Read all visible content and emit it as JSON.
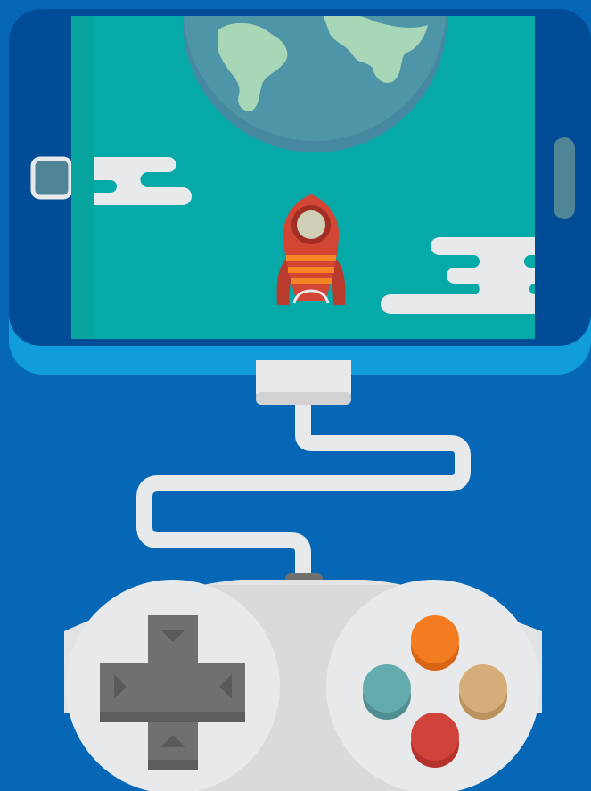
{
  "illustration": {
    "subject": "mobile-gaming",
    "icons": [
      "smartphone-icon",
      "earth-icon",
      "rocket-icon",
      "cloud-icon",
      "cable-icon",
      "gamepad-icon",
      "dpad-icon",
      "action-buttons-icon"
    ]
  },
  "colors": {
    "background": "#0567b6",
    "phone_body": "#004c97",
    "phone_base": "#119ddc",
    "screen": "#05a9a8",
    "planet": "#4f95a8",
    "land": "#a7d7b7",
    "rocket": "#d34634",
    "rocket_stripe": "#f48424",
    "cloud": "#e8e9ea",
    "controller": "#e3e3e3",
    "dpad": "#707070",
    "button_orange": "#f47c20",
    "button_teal": "#64abae",
    "button_tan": "#d6ad79",
    "button_red": "#d0433b"
  }
}
